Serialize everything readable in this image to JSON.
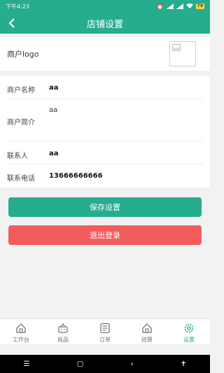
{
  "status_bar": {
    "time": "下午4:23",
    "battery": "79"
  },
  "header": {
    "title": "店铺设置"
  },
  "logo_row": {
    "label": "商户logo"
  },
  "form": {
    "rows": [
      {
        "label": "商户名称",
        "value": "aa"
      },
      {
        "label": "商户简介",
        "value": "aa"
      },
      {
        "label": "联系人",
        "value": "aa"
      },
      {
        "label": "联系电话",
        "value": "13666666666"
      }
    ]
  },
  "buttons": {
    "save": "保存设置",
    "logout": "退出登录"
  },
  "tabbar": {
    "items": [
      {
        "label": "工作台",
        "icon": "home-icon"
      },
      {
        "label": "商品",
        "icon": "basket-icon"
      },
      {
        "label": "订单",
        "icon": "order-icon"
      },
      {
        "label": "结算",
        "icon": "settlement-icon"
      },
      {
        "label": "设置",
        "icon": "gear-icon"
      }
    ],
    "active_index": 4
  },
  "colors": {
    "primary": "#26ad8e",
    "danger": "#f25c5c"
  }
}
